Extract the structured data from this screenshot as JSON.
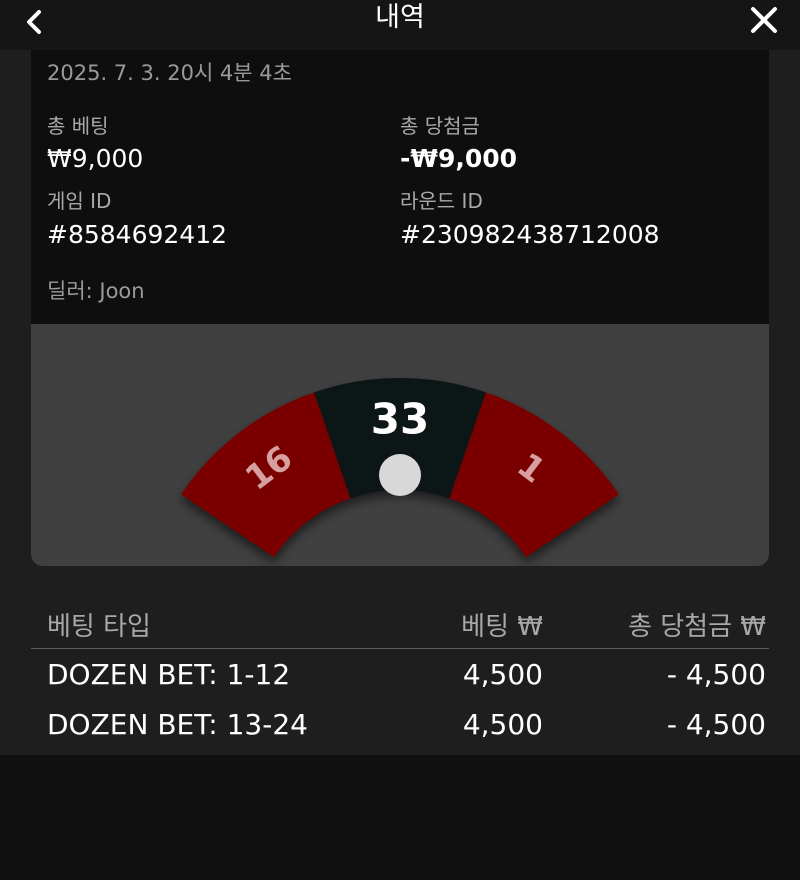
{
  "header": {
    "title": "내역",
    "back_icon": "chevron-left-icon",
    "close_icon": "close-icon"
  },
  "summary": {
    "timestamp": "2025. 7. 3. 20시 4분 4초",
    "total_bet_label": "총 베팅",
    "total_bet_value": "₩9,000",
    "total_win_label": "총 당첨금",
    "total_win_value": "-₩9,000",
    "game_id_label": "게임 ID",
    "game_id_value": "#8584692412",
    "round_id_label": "라운드 ID",
    "round_id_value": "#230982438712008",
    "dealer": "딜러: Joon"
  },
  "wheel": {
    "result": "33",
    "left_number": "16",
    "right_number": "1",
    "colors": {
      "red": "#7a0000",
      "black": "#071414",
      "ball": "#d8d8d8"
    }
  },
  "bets_table": {
    "columns": [
      "베팅 타입",
      "베팅 ₩",
      "총 당첨금 ₩"
    ],
    "rows": [
      {
        "type": "DOZEN BET: 1-12",
        "bet": "4,500",
        "win": "- 4,500"
      },
      {
        "type": "DOZEN BET: 13-24",
        "bet": "4,500",
        "win": "- 4,500"
      }
    ]
  }
}
